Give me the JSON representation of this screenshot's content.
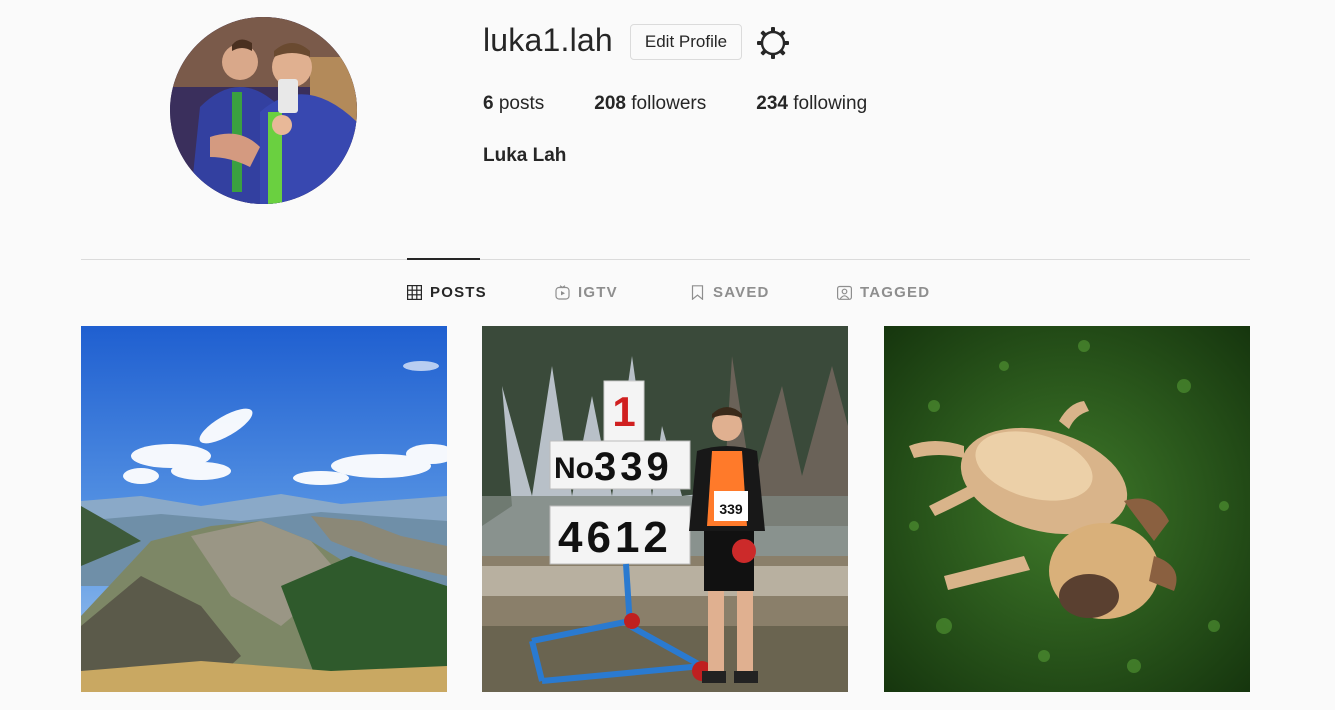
{
  "profile": {
    "username": "luka1.lah",
    "edit_label": "Edit Profile",
    "full_name": "Luka Lah",
    "stats": [
      {
        "count": "6",
        "label": "posts"
      },
      {
        "count": "208",
        "label": "followers"
      },
      {
        "count": "234",
        "label": "following"
      }
    ]
  },
  "tabs": [
    {
      "label": "POSTS",
      "icon": "grid-icon",
      "active": true
    },
    {
      "label": "IGTV",
      "icon": "igtv-icon",
      "active": false
    },
    {
      "label": "SAVED",
      "icon": "bookmark-icon",
      "active": false
    },
    {
      "label": "TAGGED",
      "icon": "tag-person-icon",
      "active": false
    }
  ],
  "posts": [
    {
      "subject": "mountain-landscape"
    },
    {
      "subject": "athlete-with-scoreboard"
    },
    {
      "subject": "dog-on-grass"
    }
  ],
  "photo_text": {
    "scoreboard_rank": "1",
    "scoreboard_no": "No.",
    "scoreboard_number": "339",
    "scoreboard_result": "4612",
    "bib_number": "339"
  },
  "colors": {
    "background": "#fafafa",
    "text": "#262626",
    "muted": "#8e8e8e",
    "border": "#dbdbdb"
  }
}
